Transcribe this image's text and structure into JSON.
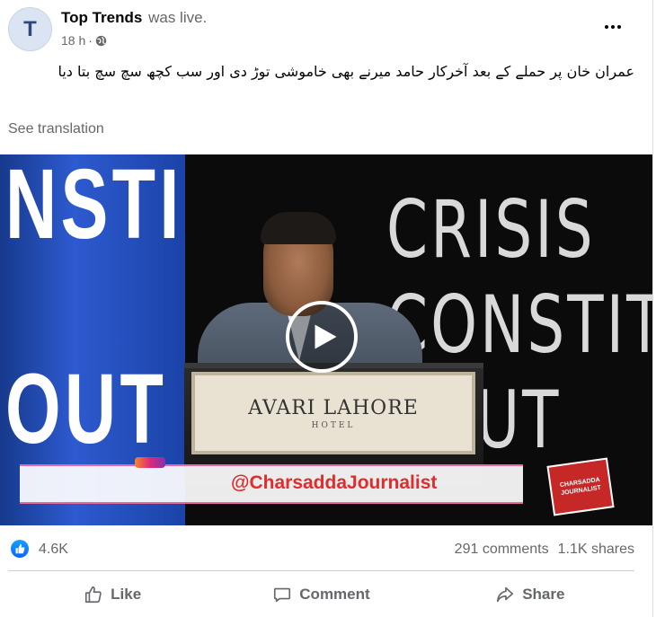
{
  "post": {
    "page_name": "Top Trends",
    "status_text": "was live.",
    "avatar_letter": "T",
    "time": "18 h",
    "privacy_icon": "globe-icon",
    "more_icon": "more-options-icon",
    "text": "عمران خان پر حملے کے بعد آخرکار حامد میرنے بھی خاموشی توڑ دی اور سب کچھ سچ سچ بتا دیا",
    "see_translation": "See translation"
  },
  "video": {
    "backdrop_left_text": "NSTI",
    "backdrop_left_text_2": "OUT",
    "backdrop_right_line1": "CRISIS",
    "backdrop_right_line2": "CONSTIT",
    "backdrop_right_line3": "SOUT",
    "podium_name": "AVARI LAHORE",
    "podium_sub": "HOTEL",
    "watermark": "@CharsaddaJournalist",
    "logo_line1": "CHARSADDA",
    "logo_line2": "JOURNALIST",
    "play_icon": "play-icon"
  },
  "stats": {
    "reactions": "4.6K",
    "comments": "291 comments",
    "shares": "1.1K shares"
  },
  "actions": {
    "like": "Like",
    "comment": "Comment",
    "share": "Share"
  },
  "colors": {
    "accent": "#0866ff",
    "secondary_text": "#65676b",
    "watermark": "#e02c2c"
  }
}
